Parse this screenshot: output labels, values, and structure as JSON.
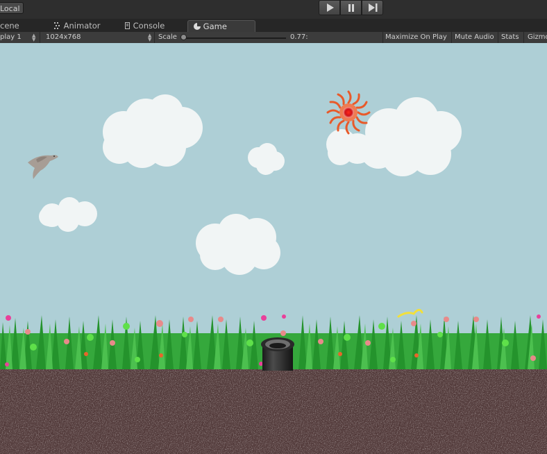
{
  "toolbar_top": {
    "local_label": "Local"
  },
  "tabs": [
    {
      "label": "cene",
      "icon": "scene-icon"
    },
    {
      "label": "Animator",
      "icon": "animator-icon"
    },
    {
      "label": "Console",
      "icon": "console-icon"
    },
    {
      "label": "Game",
      "icon": "game-icon",
      "active": true
    }
  ],
  "game_toolbar": {
    "display": "play 1",
    "resolution": "1024x768",
    "scale_label": "Scale",
    "scale_value": "0.77:",
    "maximize_on_play": "Maximize On Play",
    "mute_audio": "Mute Audio",
    "stats": "Stats",
    "gizmos": "Gizmo"
  },
  "colors": {
    "sky": "#aecfd6",
    "soil": "#533b3b",
    "grass": "#2fae3a",
    "sun": "#e85a2a"
  }
}
